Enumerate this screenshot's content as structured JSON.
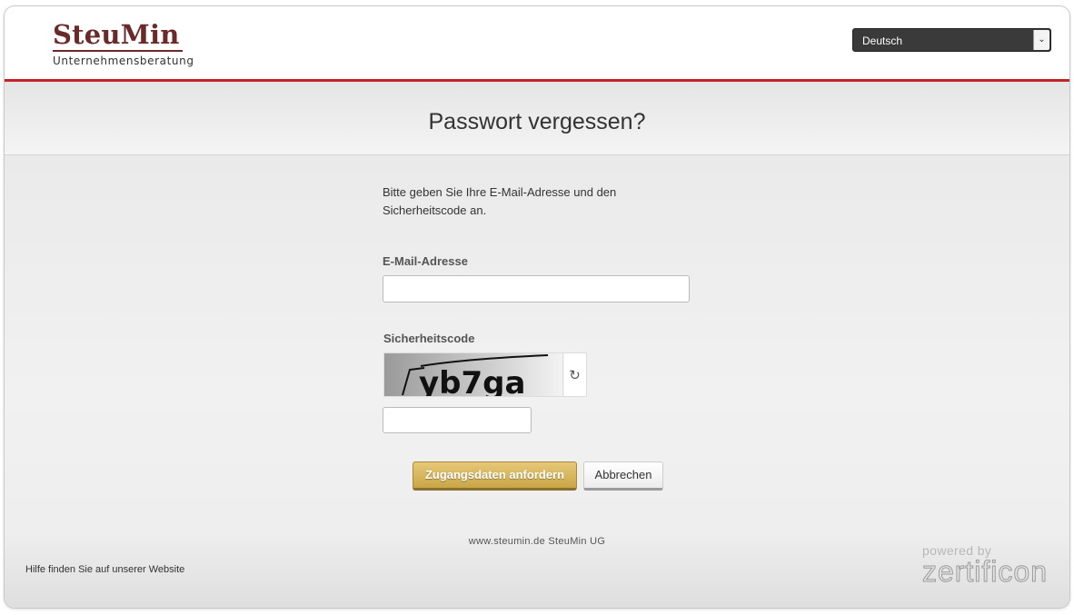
{
  "header": {
    "logo_name": "SteuMin",
    "logo_tagline": "Unternehmensberatung",
    "language_selected": "Deutsch"
  },
  "page": {
    "title": "Passwort vergessen?"
  },
  "form": {
    "intro": "Bitte geben Sie Ihre E-Mail-Adresse und den Sicherheitscode an.",
    "email_label": "E-Mail-Adresse",
    "email_value": "",
    "captcha_label": "Sicherheitscode",
    "captcha_text": "yb7ga",
    "captcha_value": ""
  },
  "buttons": {
    "submit_label": "Zugangsdaten anfordern",
    "cancel_label": "Abbrechen"
  },
  "footer": {
    "site": "www.steumin.de SteuMin UG",
    "help_link": "Hilfe finden Sie auf unserer Website",
    "powered_by": "powered by",
    "powered_brand": "zertificon"
  },
  "colors": {
    "brand": "#6b2a2a",
    "accent_line": "#c2242a",
    "primary_button": "#d4b45a"
  },
  "icons": {
    "captcha_refresh": "refresh-icon",
    "language_dropdown": "chevron-down-icon"
  }
}
